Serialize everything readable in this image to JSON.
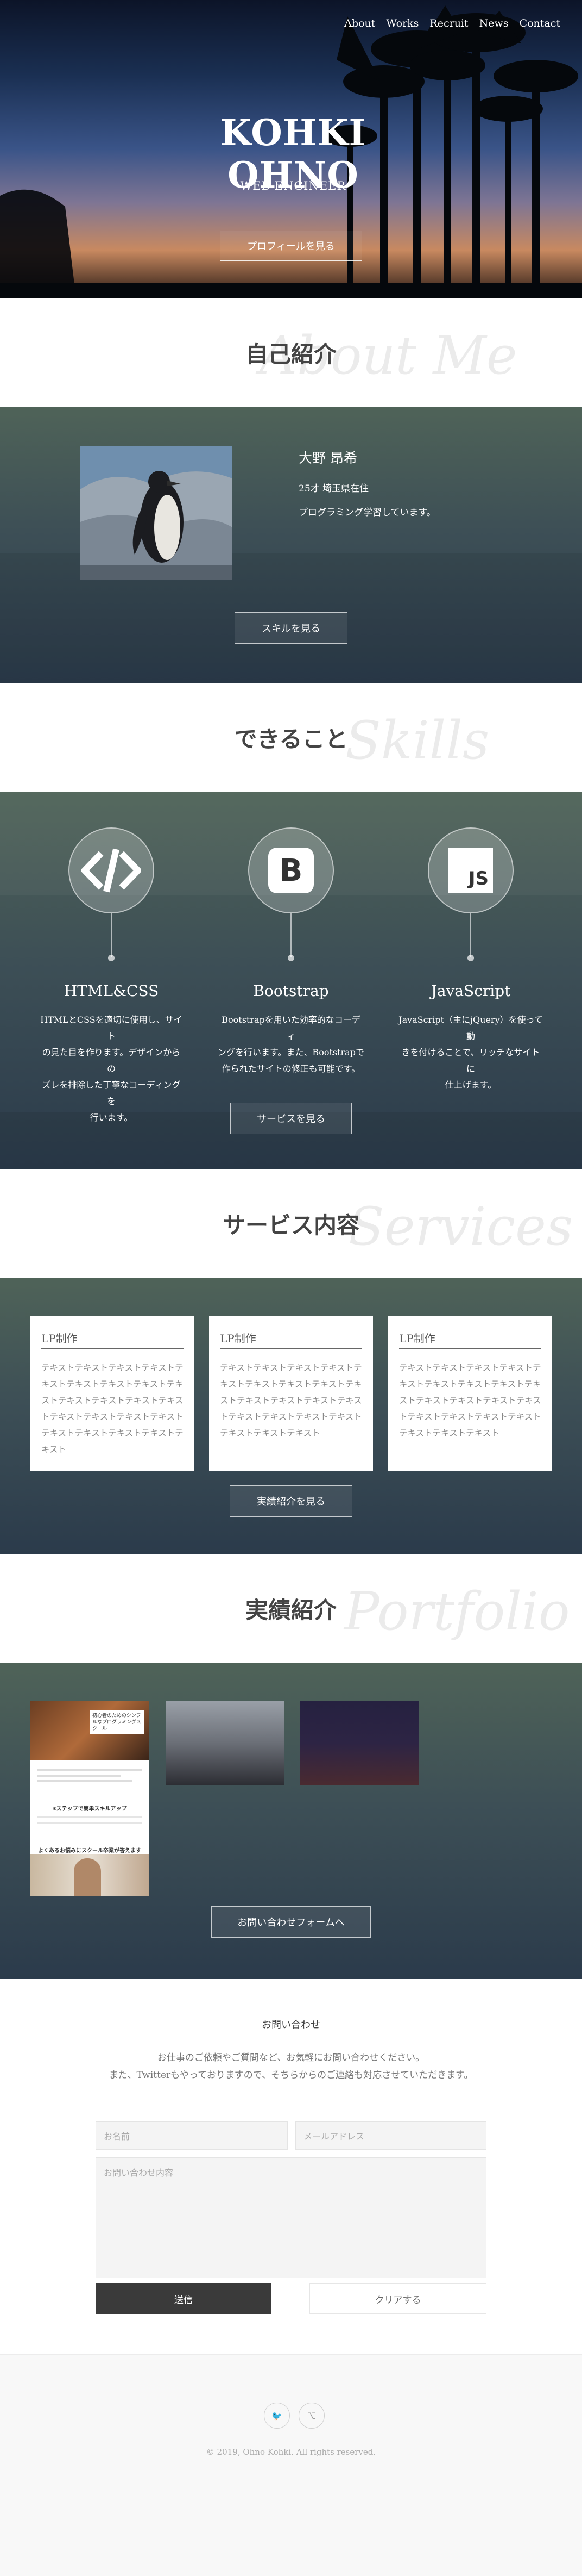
{
  "nav": {
    "items": [
      "About",
      "Works",
      "Recruit",
      "News",
      "Contact"
    ]
  },
  "hero": {
    "title": "KOHKI OHNO",
    "subtitle": "WEB ENGINEER",
    "button": "プロフィールを見る"
  },
  "sections": {
    "about": {
      "jp": "自己紹介",
      "en": "About Me"
    },
    "skills": {
      "jp": "できること",
      "en": "Skills"
    },
    "services": {
      "jp": "サービス内容",
      "en": "Services"
    },
    "portfolio": {
      "jp": "実績紹介",
      "en": "Portfolio"
    }
  },
  "about": {
    "name": "大野 昂希",
    "age": "25才 埼玉県在住",
    "desc": "プログラミング学習しています。",
    "button": "スキルを見る"
  },
  "skills": {
    "items": [
      {
        "icon": "code-icon",
        "name": "HTML&CSS",
        "lines": [
          "HTMLとCSSを適切に使用し、サイト",
          "の見た目を作ります。デザインからの",
          "ズレを排除した丁寧なコーディングを",
          "行います。"
        ]
      },
      {
        "icon": "bootstrap-icon",
        "glyph": "B",
        "name": "Bootstrap",
        "lines": [
          "Bootstrapを用いた効率的なコーディ",
          "ングを行います。また、Bootstrapで",
          "作られたサイトの修正も可能です。"
        ]
      },
      {
        "icon": "javascript-icon",
        "glyph": "JS",
        "name": "JavaScript",
        "lines": [
          "JavaScript（主にjQuery）を使って動",
          "きを付けることで、リッチなサイトに",
          "仕上げます。"
        ]
      }
    ],
    "button": "サービスを見る"
  },
  "services": {
    "cards": [
      {
        "title": "LP制作",
        "text": "テキストテキストテキストテキストテキストテキストテキストテキストテキストテキストテキストテキストテキストテキストテキストテキストテキストテキストテキストテキストテキストテキスト"
      },
      {
        "title": "LP制作",
        "text": "テキストテキストテキストテキストテキストテキストテキストテキストテキストテキストテキストテキストテキストテキストテキストテキストテキストテキストテキストテキスト"
      },
      {
        "title": "LP制作",
        "text": "テキストテキストテキストテキストテキストテキストテキストテキストテキストテキストテキストテキストテキストテキストテキストテキストテキストテキストテキストテキスト"
      }
    ],
    "button": "実績紹介を見る"
  },
  "portfolio": {
    "thumb1": {
      "heading": "初心者のためのシンプルなプログラミングスクール",
      "section": "3ステップで簡単スキルアップ",
      "sub": "よくあるお悩みにスクール卒業が答えます"
    },
    "button": "お問い合わせフォームへ"
  },
  "contact": {
    "title": "お問い合わせ",
    "p1": "お仕事のご依頼やご質問など、お気軽にお問い合わせください。",
    "p2": "また、Twitterもやっておりますので、そちらからのご連絡も対応させていただきます。",
    "name_placeholder": "お名前",
    "email_placeholder": "メールアドレス",
    "message_placeholder": "お問い合わせ内容",
    "submit": "送信",
    "clear": "クリアする"
  },
  "footer": {
    "social": [
      {
        "icon": "twitter-icon",
        "glyph": "🐦"
      },
      {
        "icon": "github-icon",
        "glyph": "⌥"
      }
    ],
    "copyright": "© 2019, Ohno Kohki. All rights reserved."
  },
  "colors": {
    "band_top": "#4f6358",
    "band_bottom": "#2b3b4b",
    "submit": "#3a3a3a"
  }
}
